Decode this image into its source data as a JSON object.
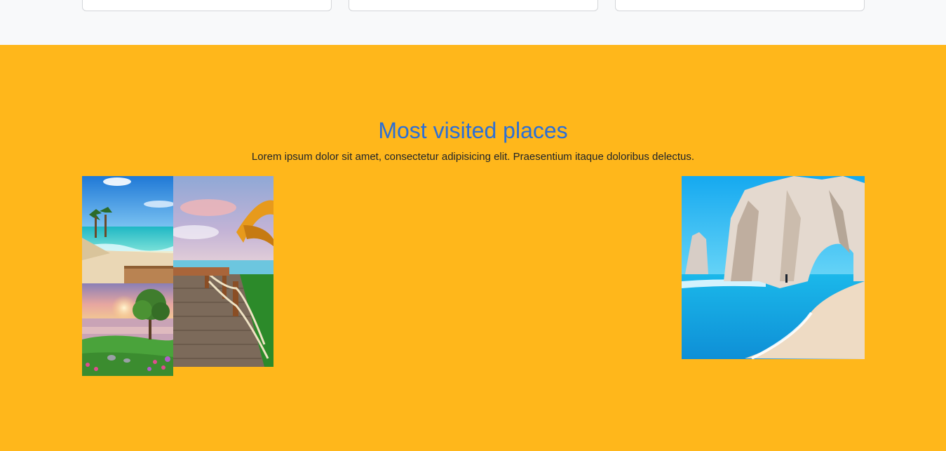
{
  "top_cards": [
    {
      "label": ""
    },
    {
      "label": ""
    },
    {
      "label": ""
    }
  ],
  "section": {
    "title": "Most visited places",
    "subtitle": "Lorem ipsum dolor sit amet, consectetur adipisicing elit. Praesentium itaque doloribus delectus.",
    "background_color": "#ffb71b",
    "title_color": "#2b6fd6"
  },
  "images": [
    {
      "name": "tropical-beach-photo"
    },
    {
      "name": "lake-sunset-photo"
    },
    {
      "name": "boardwalk-dock-photo"
    },
    {
      "name": "rock-arch-beach-photo"
    }
  ]
}
